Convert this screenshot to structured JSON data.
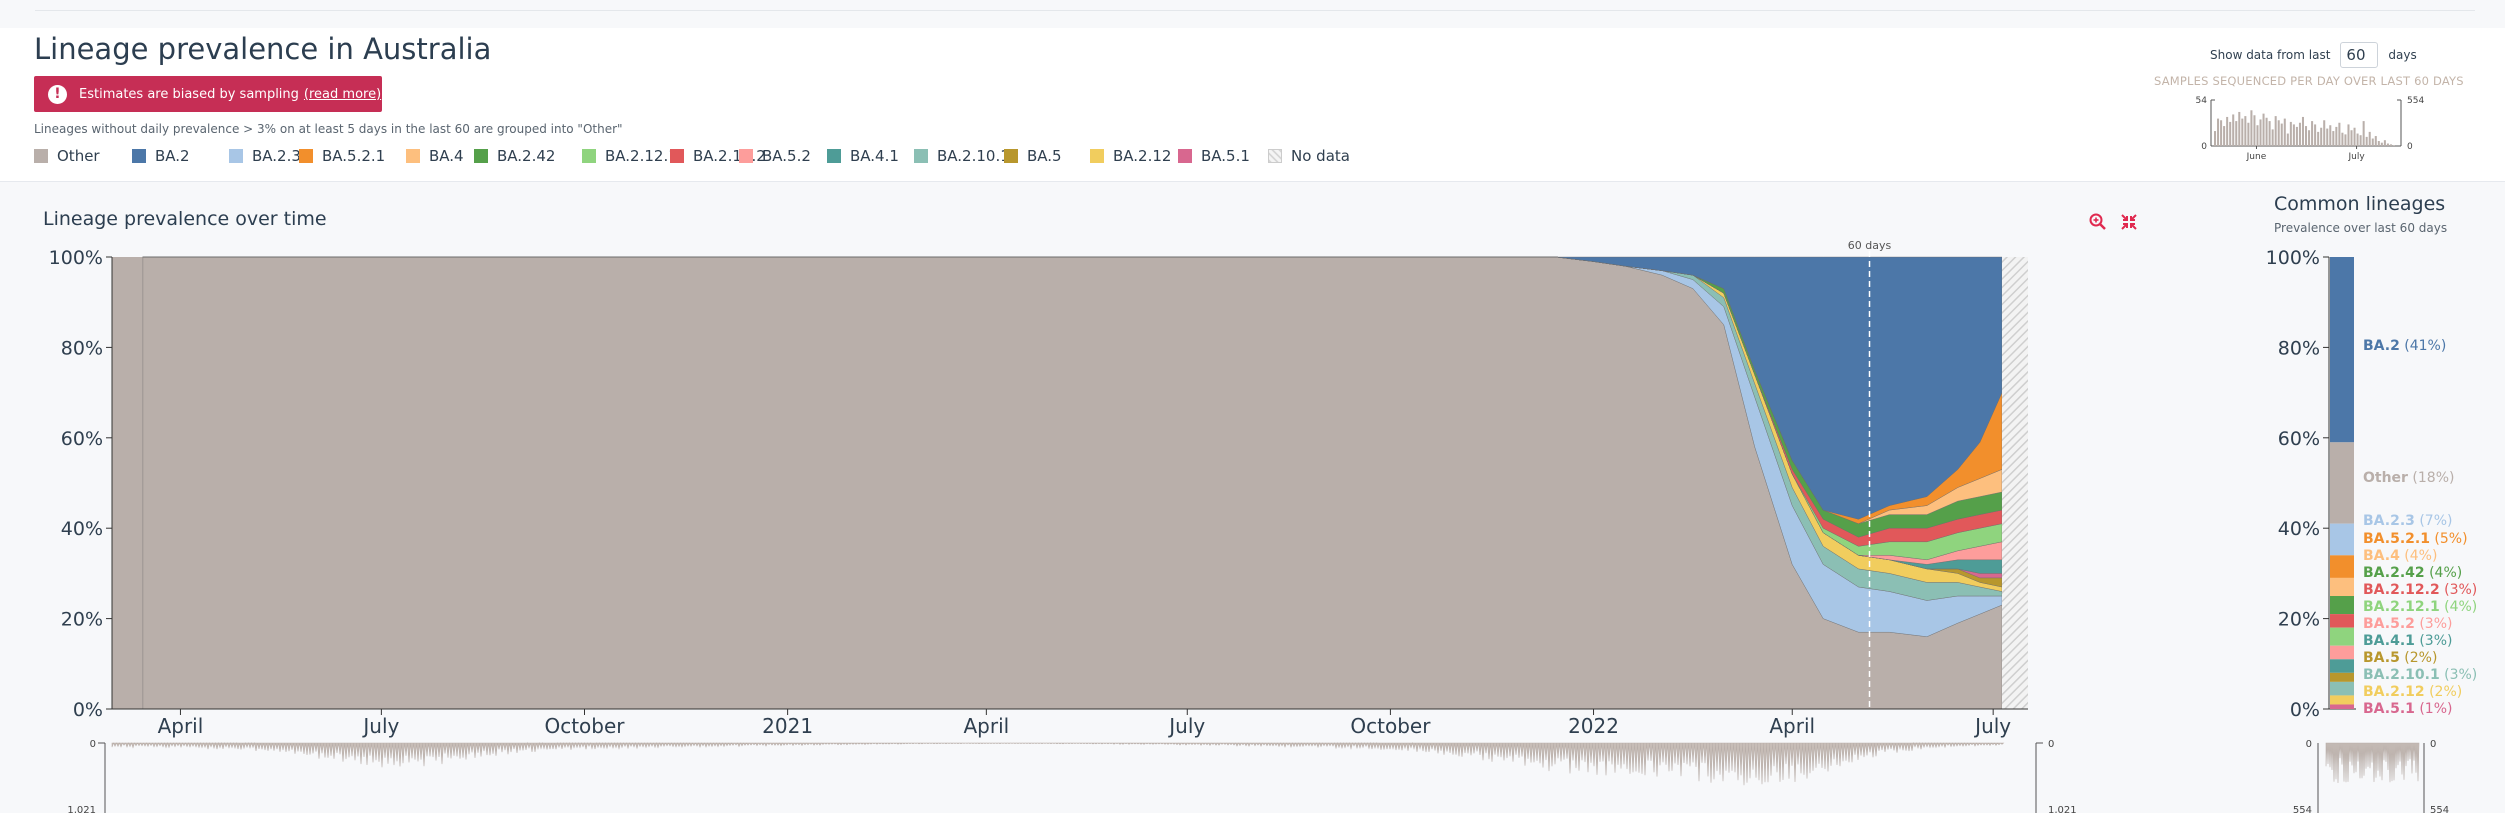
{
  "header": {
    "title": "Lineage prevalence in Australia",
    "alert_text": "Estimates are biased by sampling",
    "alert_link": "(read more)",
    "grouping_note": "Lineages without daily prevalence > 3% on at least 5 days in the last 60 are grouped into \"Other\"",
    "days_prefix": "Show data from last",
    "days_value": "60",
    "days_suffix": "days"
  },
  "legend": [
    {
      "label": "Other",
      "color": "#b9afaa"
    },
    {
      "label": "BA.2",
      "color": "#4c77a8"
    },
    {
      "label": "BA.2.3",
      "color": "#a8c6e6"
    },
    {
      "label": "BA.5.2.1",
      "color": "#f28f2c"
    },
    {
      "label": "BA.4",
      "color": "#fdbf7e"
    },
    {
      "label": "BA.2.42",
      "color": "#55a04a"
    },
    {
      "label": "BA.2.12.1",
      "color": "#8fd47e"
    },
    {
      "label": "BA.2.12.2",
      "color": "#e1585a"
    },
    {
      "label": "BA.5.2",
      "color": "#fd9d9b"
    },
    {
      "label": "BA.4.1",
      "color": "#4e9c97"
    },
    {
      "label": "BA.2.10.1",
      "color": "#8bbfb4"
    },
    {
      "label": "BA.5",
      "color": "#b8972d"
    },
    {
      "label": "BA.2.12",
      "color": "#f1cd5e"
    },
    {
      "label": "BA.5.1",
      "color": "#d8678f"
    },
    {
      "label": "No data",
      "color": "#e0e0e0"
    }
  ],
  "mini_chart": {
    "title": "SAMPLES SEQUENCED PER DAY OVER LAST 60 DAYS",
    "ymax": "554",
    "ymin": "0",
    "x_labels": [
      "June",
      "July"
    ],
    "values": [
      180,
      330,
      310,
      240,
      350,
      290,
      380,
      300,
      410,
      330,
      360,
      280,
      430,
      370,
      250,
      320,
      390,
      340,
      300,
      200,
      360,
      310,
      270,
      330,
      150,
      290,
      260,
      230,
      280,
      350,
      240,
      190,
      300,
      260,
      170,
      220,
      310,
      210,
      250,
      180,
      230,
      280,
      160,
      140,
      260,
      190,
      220,
      150,
      130,
      300,
      110,
      170,
      90,
      120,
      60,
      40,
      70,
      30,
      20,
      10
    ]
  },
  "chart": {
    "title": "Lineage prevalence over time",
    "zoom_icon": "zoom-in-icon",
    "reset_icon": "collapse-icon",
    "marker_label": "60 days",
    "y_ticks": [
      "100%",
      "80%",
      "60%",
      "40%",
      "20%",
      "0%"
    ],
    "x_ticks": [
      "April",
      "July",
      "October",
      "2021",
      "April",
      "July",
      "October",
      "2022",
      "April",
      "July"
    ],
    "samples_axis": {
      "top": "0",
      "bottom": "1,021"
    }
  },
  "chart_data": [
    {
      "type": "area",
      "title": "Lineage prevalence over time",
      "ylabel": "",
      "ylim": [
        0,
        100
      ],
      "x": [
        "2020-03-15",
        "2020-06-01",
        "2020-09-01",
        "2020-12-01",
        "2021-03-01",
        "2021-06-01",
        "2021-09-01",
        "2021-11-01",
        "2021-12-15",
        "2022-01-01",
        "2022-01-15",
        "2022-02-01",
        "2022-02-15",
        "2022-03-01",
        "2022-03-15",
        "2022-04-01",
        "2022-04-15",
        "2022-05-01",
        "2022-05-15",
        "2022-06-01",
        "2022-06-15",
        "2022-06-25",
        "2022-07-05"
      ],
      "series": [
        {
          "name": "Other",
          "values": [
            100,
            100,
            100,
            100,
            100,
            100,
            100,
            100,
            100,
            99,
            98,
            96,
            93,
            85,
            58,
            32,
            20,
            17,
            17,
            16,
            19,
            21,
            23
          ]
        },
        {
          "name": "BA.2.3",
          "values": [
            0,
            0,
            0,
            0,
            0,
            0,
            0,
            0,
            0,
            0,
            0,
            1,
            2,
            4,
            11,
            13,
            12,
            10,
            9,
            8,
            6,
            4,
            2
          ]
        },
        {
          "name": "BA.2.10.1",
          "values": [
            0,
            0,
            0,
            0,
            0,
            0,
            0,
            0,
            0,
            0,
            0,
            0,
            1,
            2,
            3,
            4,
            4,
            4,
            4,
            4,
            3,
            2,
            1
          ]
        },
        {
          "name": "BA.2.12",
          "values": [
            0,
            0,
            0,
            0,
            0,
            0,
            0,
            0,
            0,
            0,
            0,
            0,
            0,
            1,
            2,
            3,
            3,
            3,
            3,
            3,
            2,
            1,
            1
          ]
        },
        {
          "name": "BA.5",
          "values": [
            0,
            0,
            0,
            0,
            0,
            0,
            0,
            0,
            0,
            0,
            0,
            0,
            0,
            0,
            0,
            0,
            0,
            0,
            0,
            0,
            1,
            1,
            2
          ]
        },
        {
          "name": "BA.5.1",
          "values": [
            0,
            0,
            0,
            0,
            0,
            0,
            0,
            0,
            0,
            0,
            0,
            0,
            0,
            0,
            0,
            0,
            0,
            0,
            0,
            0,
            0,
            1,
            1
          ]
        },
        {
          "name": "BA.4.1",
          "values": [
            0,
            0,
            0,
            0,
            0,
            0,
            0,
            0,
            0,
            0,
            0,
            0,
            0,
            0,
            0,
            0,
            0,
            0,
            0,
            1,
            2,
            3,
            3
          ]
        },
        {
          "name": "BA.5.2",
          "values": [
            0,
            0,
            0,
            0,
            0,
            0,
            0,
            0,
            0,
            0,
            0,
            0,
            0,
            0,
            0,
            0,
            0,
            0,
            1,
            1,
            2,
            3,
            4
          ]
        },
        {
          "name": "BA.2.12.1",
          "values": [
            0,
            0,
            0,
            0,
            0,
            0,
            0,
            0,
            0,
            0,
            0,
            0,
            0,
            0,
            0,
            0,
            1,
            2,
            3,
            4,
            4,
            4,
            4
          ]
        },
        {
          "name": "BA.2.12.2",
          "values": [
            0,
            0,
            0,
            0,
            0,
            0,
            0,
            0,
            0,
            0,
            0,
            0,
            0,
            0,
            0,
            1,
            2,
            2,
            3,
            3,
            3,
            3,
            3
          ]
        },
        {
          "name": "BA.2.42",
          "values": [
            0,
            0,
            0,
            0,
            0,
            0,
            0,
            0,
            0,
            0,
            0,
            0,
            0,
            1,
            1,
            2,
            2,
            3,
            3,
            3,
            4,
            4,
            4
          ]
        },
        {
          "name": "BA.4",
          "values": [
            0,
            0,
            0,
            0,
            0,
            0,
            0,
            0,
            0,
            0,
            0,
            0,
            0,
            0,
            0,
            0,
            0,
            0,
            1,
            2,
            3,
            4,
            5
          ]
        },
        {
          "name": "BA.5.2.1",
          "values": [
            0,
            0,
            0,
            0,
            0,
            0,
            0,
            0,
            0,
            0,
            0,
            0,
            0,
            0,
            0,
            0,
            0,
            1,
            1,
            2,
            4,
            8,
            17
          ]
        },
        {
          "name": "BA.2",
          "values": [
            0,
            0,
            0,
            0,
            0,
            0,
            0,
            0,
            0,
            1,
            2,
            3,
            4,
            7,
            25,
            45,
            56,
            58,
            55,
            53,
            47,
            41,
            30
          ]
        }
      ]
    },
    {
      "type": "bar",
      "title": "Common lineages",
      "subtitle": "Prevalence over last 60 days",
      "ylim": [
        0,
        100
      ],
      "categories": [
        "BA.2",
        "Other",
        "BA.2.3",
        "BA.5.2.1",
        "BA.4",
        "BA.2.42",
        "BA.2.12.2",
        "BA.2.12.1",
        "BA.5.2",
        "BA.4.1",
        "BA.5",
        "BA.2.10.1",
        "BA.2.12",
        "BA.5.1"
      ],
      "values": [
        41,
        18,
        7,
        5,
        4,
        4,
        3,
        4,
        3,
        3,
        2,
        3,
        2,
        1
      ],
      "labels": [
        "BA.2 (41%)",
        "Other (18%)",
        "BA.2.3 (7%)",
        "BA.5.2.1 (5%)",
        "BA.4 (4%)",
        "BA.2.42 (4%)",
        "BA.2.12.2 (3%)",
        "BA.2.12.1 (4%)",
        "BA.5.2 (3%)",
        "BA.4.1 (3%)",
        "BA.5 (2%)",
        "BA.2.10.1 (3%)",
        "BA.2.12 (2%)",
        "BA.5.1 (1%)"
      ]
    }
  ],
  "side": {
    "title": "Common lineages",
    "subtitle": "Prevalence over last 60 days",
    "y_ticks": [
      "100%",
      "80%",
      "60%",
      "40%",
      "20%",
      "0%"
    ],
    "samples_axis": {
      "top": "0",
      "bottom": "554"
    }
  }
}
